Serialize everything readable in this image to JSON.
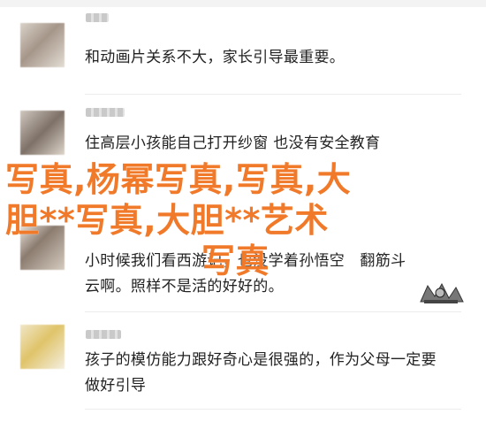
{
  "comments": [
    {
      "text": "和动画片关系不大，家长引导最重要。"
    },
    {
      "text": "住高层小孩能自己打开纱窗 也没有安全教育"
    },
    {
      "text": "小时候我们看西游记，也没学着孙悟空　翻筋斗云啊。照样不是活的好好的。"
    },
    {
      "text": "孩子的模仿能力跟好奇心是很强的，作为父母一定要做好引导"
    }
  ],
  "overlay": {
    "line1": "写真,杨幂写真,写真,大",
    "line2": "胆**写真,大胆**艺术",
    "line3": "写真"
  },
  "colors": {
    "overlay_text": "#f07a2a",
    "comment_text": "#222222",
    "divider": "#ececec"
  },
  "icons": {
    "avatars": [
      "avatar-1",
      "avatar-2",
      "avatar-3",
      "avatar-4"
    ],
    "comic": "comic-sticker-icon"
  }
}
